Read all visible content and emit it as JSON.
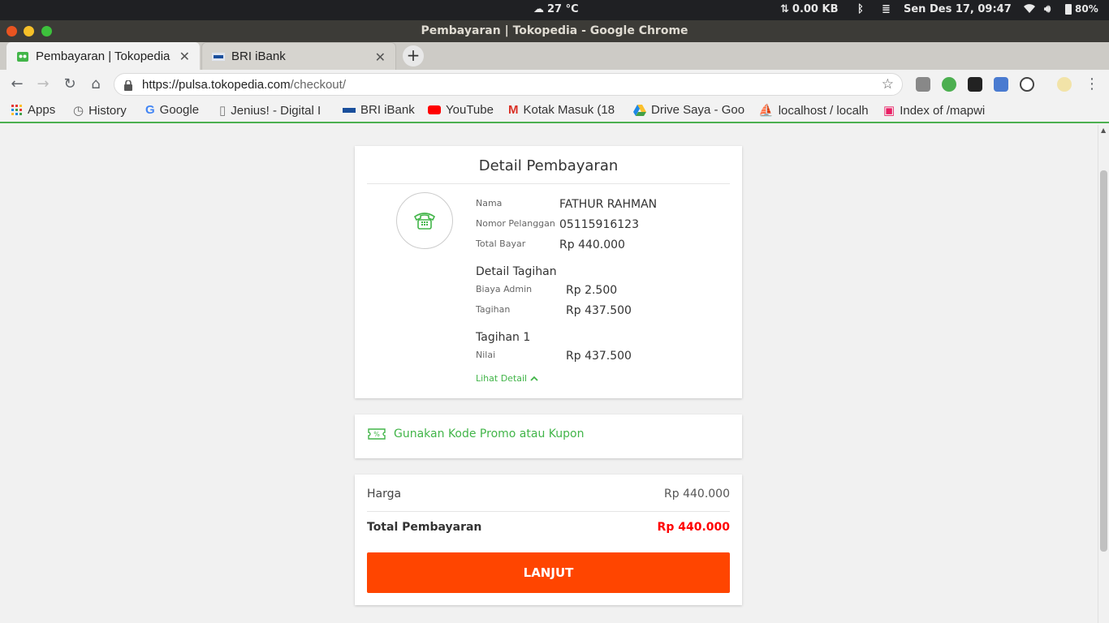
{
  "system": {
    "weather": "27 °C",
    "network": "0.00 KB",
    "datetime": "Sen Des 17, 09:47",
    "battery": "80%"
  },
  "window": {
    "title": "Pembayaran | Tokopedia - Google Chrome"
  },
  "tabs": [
    {
      "label": "Pembayaran | Tokopedia",
      "active": true
    },
    {
      "label": "BRI iBank",
      "active": false
    }
  ],
  "address": {
    "url_host": "https://pulsa.tokopedia.com",
    "url_path": "/checkout/"
  },
  "bookmarks": [
    {
      "label": "Apps"
    },
    {
      "label": "History"
    },
    {
      "label": "Google"
    },
    {
      "label": "Jenius! - Digital I"
    },
    {
      "label": "BRI iBank"
    },
    {
      "label": "YouTube"
    },
    {
      "label": "Kotak Masuk (18"
    },
    {
      "label": "Drive Saya - Goo"
    },
    {
      "label": "localhost / localh"
    },
    {
      "label": "Index of /mapwi"
    }
  ],
  "detail": {
    "title": "Detail Pembayaran",
    "nama_label": "Nama",
    "nama_value": "FATHUR RAHMAN",
    "nomor_label": "Nomor Pelanggan",
    "nomor_value": "05115916123",
    "total_label": "Total Bayar",
    "total_value": "Rp 440.000",
    "tagihan_heading": "Detail Tagihan",
    "biaya_label": "Biaya Admin",
    "biaya_value": "Rp 2.500",
    "tagihan_label": "Tagihan",
    "tagihan_value": "Rp 437.500",
    "tagihan1_heading": "Tagihan 1",
    "nilai_label": "Nilai",
    "nilai_value": "Rp 437.500",
    "lihat_detail": "Lihat Detail"
  },
  "promo": {
    "label": "Gunakan Kode Promo atau Kupon"
  },
  "summary": {
    "harga_label": "Harga",
    "harga_value": "Rp 440.000",
    "total_label": "Total Pembayaran",
    "total_value": "Rp 440.000",
    "button_label": "LANJUT"
  },
  "colors": {
    "accent_green": "#42b549",
    "button_orange": "#ff4500",
    "total_red": "#ff0000"
  }
}
